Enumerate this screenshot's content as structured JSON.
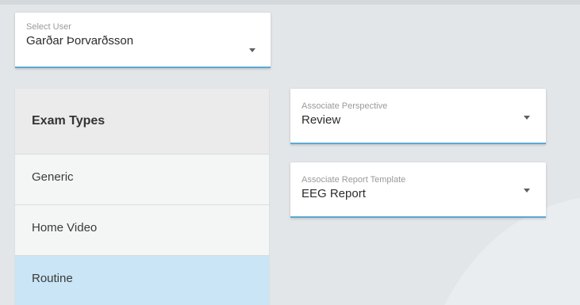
{
  "select_user": {
    "label": "Select User",
    "value": "Garðar Þorvarðsson"
  },
  "exam_types": {
    "header": "Exam Types",
    "items": [
      {
        "label": "Generic",
        "selected": false
      },
      {
        "label": "Home Video",
        "selected": false
      },
      {
        "label": "Routine",
        "selected": true
      }
    ]
  },
  "associate_perspective": {
    "label": "Associate Perspective",
    "value": "Review"
  },
  "associate_report_template": {
    "label": "Associate Report Template",
    "value": "EEG Report"
  },
  "colors": {
    "accent_underline": "#5aa9d3",
    "selected_row": "#c9e5f6",
    "background": "#e3e6e8"
  }
}
